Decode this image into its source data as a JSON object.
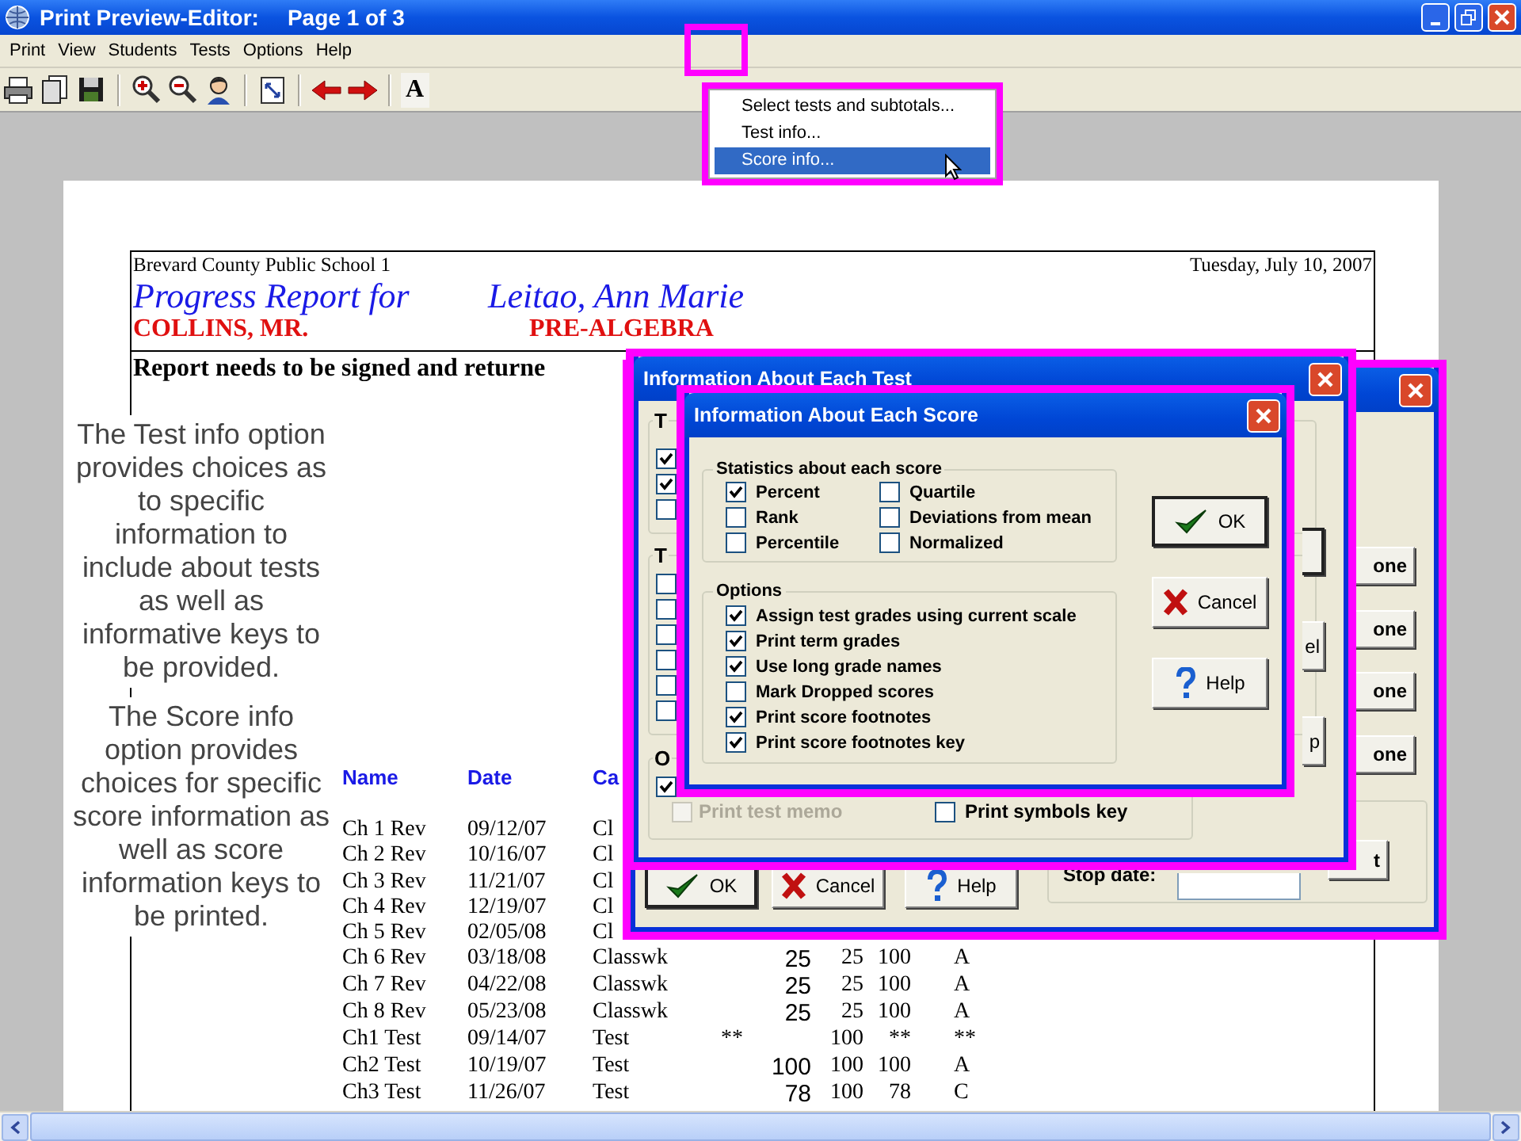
{
  "window": {
    "title": "Print Preview-Editor:",
    "page_label": "Page 1 of 3"
  },
  "menu_bar": [
    "Print",
    "View",
    "Students",
    "Tests",
    "Options",
    "Help"
  ],
  "toolbar": {
    "font_button": "A"
  },
  "popup_menu": [
    {
      "label": "Select tests and subtotals...",
      "selected": false
    },
    {
      "label": "Test info...",
      "selected": false
    },
    {
      "label": "Score info...",
      "selected": true
    }
  ],
  "report": {
    "school": "Brevard County Public School 1",
    "date": "Tuesday, July 10, 2007",
    "title": "Progress Report for",
    "student": "Leitao, Ann Marie",
    "teacher": "COLLINS, MR.",
    "course": "PRE-ALGEBRA",
    "notice": "Report needs to be signed and returne",
    "columns": [
      "Name",
      "Date",
      "Ca"
    ],
    "rows": [
      {
        "name": "Ch 1 Rev",
        "date": "09/12/07",
        "category": "Cl"
      },
      {
        "name": "Ch 2 Rev",
        "date": "10/16/07",
        "category": "Cl"
      },
      {
        "name": "Ch 3 Rev",
        "date": "11/21/07",
        "category": "Cl"
      },
      {
        "name": "Ch 4 Rev",
        "date": "12/19/07",
        "category": "Cl"
      },
      {
        "name": "Ch 5 Rev",
        "date": "02/05/08",
        "category": "Cl"
      },
      {
        "name": "Ch 6 Rev",
        "date": "03/18/08",
        "category": "Classwk",
        "score": "25",
        "max": "25",
        "percent": "100",
        "grade": "A"
      },
      {
        "name": "Ch 7 Rev",
        "date": "04/22/08",
        "category": "Classwk",
        "score": "25",
        "max": "25",
        "percent": "100",
        "grade": "A"
      },
      {
        "name": "Ch 8 Rev",
        "date": "05/23/08",
        "category": "Classwk",
        "score": "25",
        "max": "25",
        "percent": "100",
        "grade": "A"
      },
      {
        "name": "Ch1 Test",
        "date": "09/14/07",
        "category": "Test",
        "note": "**",
        "max": "100",
        "percent": "**",
        "grade": "**"
      },
      {
        "name": "Ch2 Test",
        "date": "10/19/07",
        "category": "Test",
        "score": "100",
        "max": "100",
        "percent": "100",
        "grade": "A"
      },
      {
        "name": "Ch3 Test",
        "date": "11/26/07",
        "category": "Test",
        "score": "78",
        "max": "100",
        "percent": "78",
        "grade": "C"
      }
    ]
  },
  "dialog_behind": {
    "partial_buttons": [
      "one",
      "one",
      "one",
      "one",
      "t"
    ],
    "stop_date_label": "Stop date:",
    "buttons": [
      {
        "label": "OK",
        "kind": "ok"
      },
      {
        "label": "Cancel",
        "kind": "cancel"
      },
      {
        "label": "Help",
        "kind": "help"
      }
    ]
  },
  "test_dialog": {
    "title": "Information About Each Test",
    "groups": [
      {
        "label": "T",
        "checkboxes": [
          {
            "checked": true
          },
          {
            "checked": true
          },
          {
            "checked": false
          }
        ]
      },
      {
        "label": "T",
        "checkboxes": [
          {
            "checked": false
          },
          {
            "checked": false
          },
          {
            "checked": false
          },
          {
            "checked": false
          },
          {
            "checked": false
          },
          {
            "checked": false
          }
        ]
      },
      {
        "label": "O",
        "checkboxes": [
          {
            "checked": true
          }
        ]
      }
    ],
    "memo": {
      "label": "Print test memo",
      "checked": false,
      "disabled": true
    },
    "symbols_key": {
      "label": "Print symbols key",
      "checked": false
    },
    "partial_buttons": [
      "el",
      "p"
    ]
  },
  "score_dialog": {
    "title": "Information About Each Score",
    "statistics": {
      "label": "Statistics about each score",
      "items": [
        {
          "label": "Percent",
          "checked": true
        },
        {
          "label": "Quartile",
          "checked": false
        },
        {
          "label": "Rank",
          "checked": false
        },
        {
          "label": "Deviations from mean",
          "checked": false
        },
        {
          "label": "Percentile",
          "checked": false
        },
        {
          "label": "Normalized",
          "checked": false
        }
      ]
    },
    "options": {
      "label": "Options",
      "items": [
        {
          "label": "Assign test grades using current scale",
          "checked": true
        },
        {
          "label": "Print term grades",
          "checked": true
        },
        {
          "label": "Use long grade names",
          "checked": true
        },
        {
          "label": "Mark Dropped scores",
          "checked": false
        },
        {
          "label": "Print score footnotes",
          "checked": true
        },
        {
          "label": "Print score footnotes key",
          "checked": true
        }
      ]
    },
    "buttons": [
      {
        "label": "OK",
        "kind": "ok"
      },
      {
        "label": "Cancel",
        "kind": "cancel"
      },
      {
        "label": "Help",
        "kind": "help"
      }
    ]
  },
  "captions": [
    "The Test info option provides choices as to specific information to include about tests as well as informative keys to be provided.",
    "The Score info option provides choices for specific score information as well as score information keys to be printed."
  ]
}
